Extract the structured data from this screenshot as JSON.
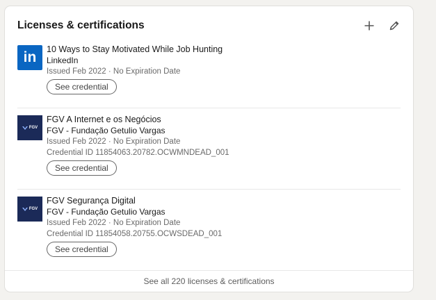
{
  "section": {
    "title": "Licenses & certifications",
    "add_icon": "plus-icon",
    "edit_icon": "pencil-icon"
  },
  "colors": {
    "linkedin_blue": "#0a66c2",
    "fgv_navy": "#1b2a58",
    "page_bg": "#f3f2ef"
  },
  "items": [
    {
      "logo": "linkedin-logo",
      "logo_text": "in",
      "name": "10 Ways to Stay Motivated While Job Hunting",
      "issuer": "LinkedIn",
      "issued": "Issued Feb 2022 · No Expiration Date",
      "credential_id": "",
      "button": "See credential"
    },
    {
      "logo": "fgv-logo",
      "logo_text": "FGV",
      "name": "FGV A Internet e os Negócios",
      "issuer": "FGV - Fundação Getulio Vargas",
      "issued": "Issued Feb 2022 · No Expiration Date",
      "credential_id": "Credential ID 11854063.20782.OCWMNDEAD_001",
      "button": "See credential"
    },
    {
      "logo": "fgv-logo",
      "logo_text": "FGV",
      "name": "FGV Segurança Digital",
      "issuer": "FGV - Fundação Getulio Vargas",
      "issued": "Issued Feb 2022 · No Expiration Date",
      "credential_id": "Credential ID 11854058.20755.OCWSDEAD_001",
      "button": "See credential"
    }
  ],
  "footer": {
    "see_all": "See all 220 licenses & certifications"
  }
}
